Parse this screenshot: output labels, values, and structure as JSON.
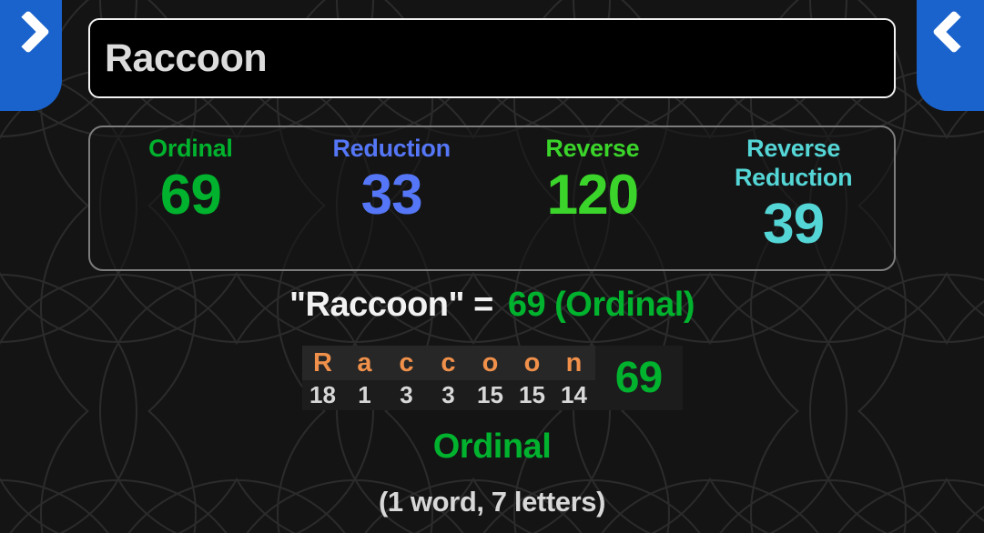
{
  "nav": {
    "left_tab": {
      "icon": "chevron-right-icon",
      "label": ""
    },
    "right_tab": {
      "icon": "chevron-left-icon",
      "label": ""
    },
    "tab_color": "#1a63cc"
  },
  "search": {
    "value": "Raccoon",
    "placeholder": "Enter word or phrase"
  },
  "ciphers": [
    {
      "name": "Ordinal",
      "value": "69",
      "color": "#00b22d"
    },
    {
      "name": "Reduction",
      "value": "33",
      "color": "#5577f7"
    },
    {
      "name": "Reverse",
      "value": "120",
      "color": "#3ad42a"
    },
    {
      "name": "Reverse Reduction",
      "value": "39",
      "color": "#55d6d6"
    }
  ],
  "equation": {
    "quoted_phrase": "\"Raccoon\" =",
    "result": "69 (Ordinal)",
    "result_color": "#00b22d"
  },
  "breakdown": {
    "letters": [
      "R",
      "a",
      "c",
      "c",
      "o",
      "o",
      "n"
    ],
    "values": [
      "18",
      "1",
      "3",
      "3",
      "15",
      "15",
      "14"
    ],
    "total": "69",
    "letter_color": "#f0904a",
    "value_color": "#d8d8d8",
    "total_color": "#00b22d"
  },
  "footer": {
    "cipher_label": "Ordinal",
    "cipher_label_color": "#00b22d",
    "word_count": "(1 word, 7 letters)"
  }
}
